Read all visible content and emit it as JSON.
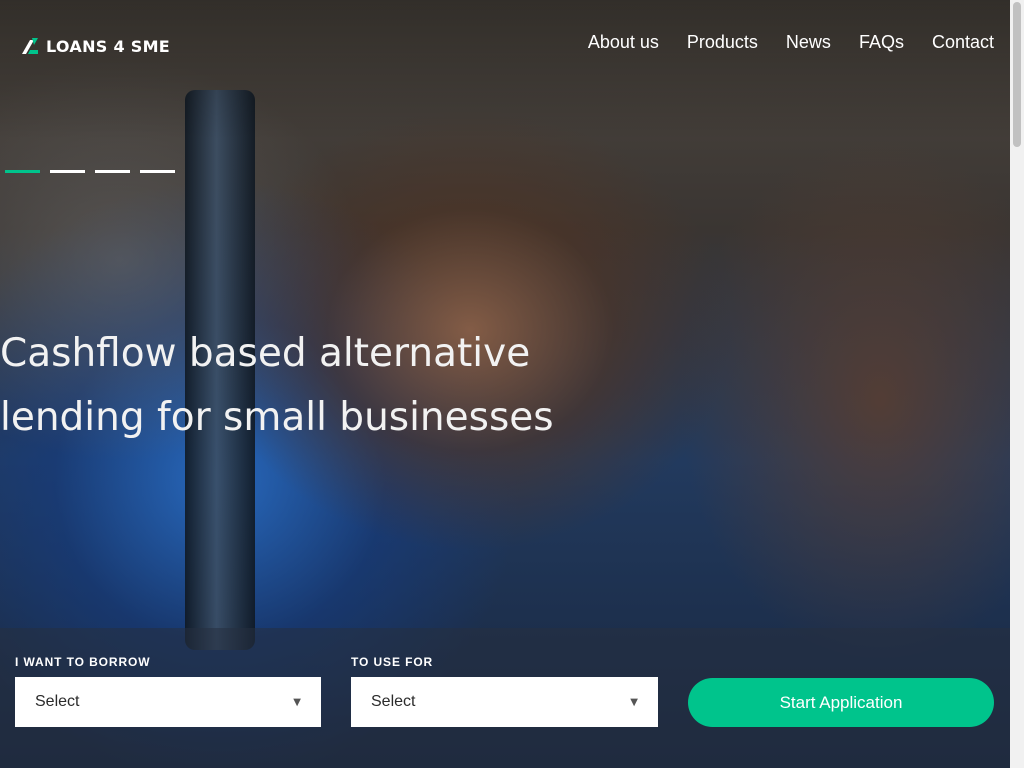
{
  "brand": {
    "name": "LOANS 4 SME",
    "logo_icon": "loans-logo-icon",
    "accent_color": "#00c48c"
  },
  "nav": {
    "items": [
      {
        "label": "About us"
      },
      {
        "label": "Products"
      },
      {
        "label": "News"
      },
      {
        "label": "FAQs"
      },
      {
        "label": "Contact"
      }
    ]
  },
  "slider": {
    "count": 4,
    "active_index": 0
  },
  "hero": {
    "headline_line1": "Cashflow based alternative",
    "headline_line2": "lending for small businesses"
  },
  "form": {
    "borrow": {
      "label": "I WANT TO BORROW",
      "value": "Select"
    },
    "use_for": {
      "label": "TO USE FOR",
      "value": "Select"
    },
    "submit_label": "Start Application"
  }
}
